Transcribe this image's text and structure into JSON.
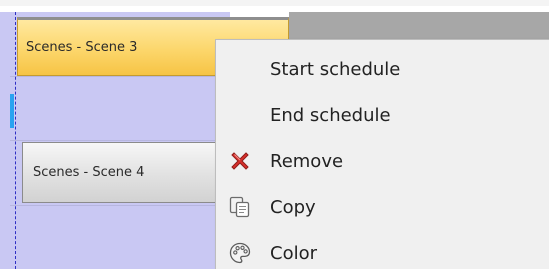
{
  "timeline": {
    "scenes": [
      {
        "label": "Scenes - Scene 3",
        "state": "selected"
      },
      {
        "label": "Scenes - Scene 4",
        "state": "normal"
      }
    ]
  },
  "context_menu": {
    "items": [
      {
        "label": "Start schedule",
        "icon": null
      },
      {
        "label": "End schedule",
        "icon": null
      },
      {
        "label": "Remove",
        "icon": "remove-icon"
      },
      {
        "label": "Copy",
        "icon": "copy-icon"
      },
      {
        "label": "Color",
        "icon": "palette-icon"
      }
    ]
  },
  "colors": {
    "lane_background": "#c9c8f3",
    "selected_scene": "#fcd66b",
    "menu_background": "#f0f0f0",
    "remove_icon": "#d9302c"
  }
}
